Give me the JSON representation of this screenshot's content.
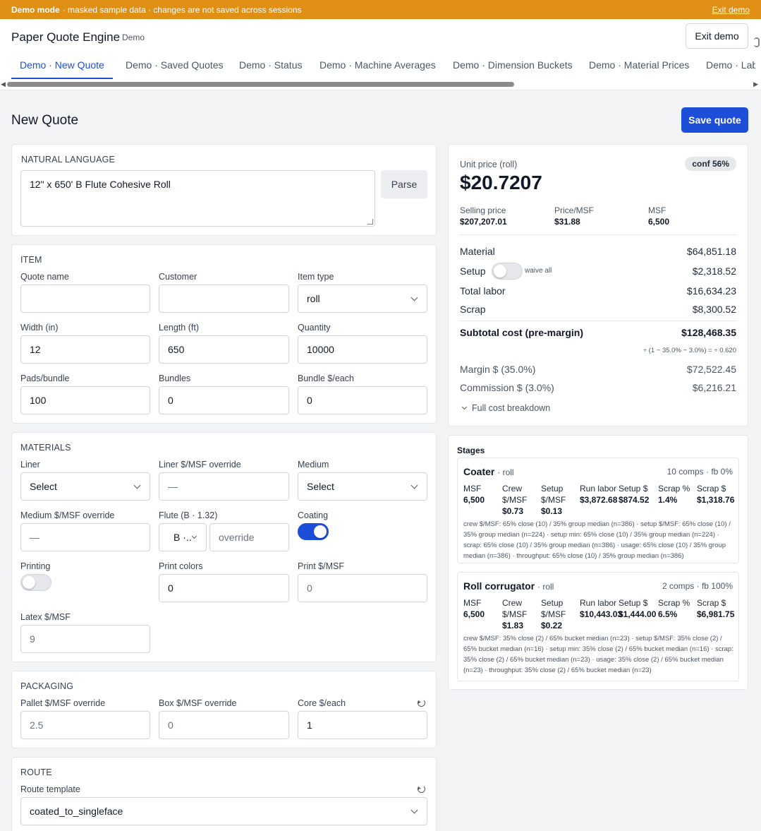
{
  "banner": {
    "mode": "Demo mode",
    "message": "· masked sample data · changes are not saved across sessions",
    "exit": "Exit demo"
  },
  "header": {
    "app_title": "Paper Quote Engine",
    "app_tag": "Demo",
    "exit_button": "Exit demo"
  },
  "tabs": [
    {
      "label": "Demo · New Quote",
      "active": true
    },
    {
      "label": "Demo · Saved Quotes"
    },
    {
      "label": "Demo · Status"
    },
    {
      "label": "Demo · Machine Averages"
    },
    {
      "label": "Demo · Dimension Buckets"
    },
    {
      "label": "Demo · Material Prices"
    },
    {
      "label": "Demo · Lab"
    }
  ],
  "page": {
    "title": "New Quote",
    "save_button": "Save quote"
  },
  "natural_language": {
    "title": "NATURAL LANGUAGE",
    "value": "12\" x 650' B Flute Cohesive Roll",
    "parse_button": "Parse"
  },
  "item": {
    "title": "ITEM",
    "quote_name": {
      "label": "Quote name",
      "value": ""
    },
    "customer": {
      "label": "Customer",
      "value": ""
    },
    "item_type": {
      "label": "Item type",
      "value": "roll"
    },
    "width": {
      "label": "Width (in)",
      "value": "12"
    },
    "length": {
      "label": "Length (ft)",
      "value": "650"
    },
    "quantity": {
      "label": "Quantity",
      "value": "10000"
    },
    "pads_bundle": {
      "label": "Pads/bundle",
      "value": "100"
    },
    "bundles": {
      "label": "Bundles",
      "value": "0"
    },
    "bundle_each": {
      "label": "Bundle $/each",
      "value": "0"
    }
  },
  "materials": {
    "title": "MATERIALS",
    "liner": {
      "label": "Liner",
      "value": "Select"
    },
    "liner_override": {
      "label": "Liner $/MSF override",
      "value": "—"
    },
    "medium": {
      "label": "Medium",
      "value": "Select"
    },
    "medium_override": {
      "label": "Medium $/MSF override",
      "value": "—"
    },
    "flute": {
      "label": "Flute (B · 1.32)",
      "value": "B ·..",
      "override_placeholder": "override"
    },
    "coating": {
      "label": "Coating",
      "on": true
    },
    "printing": {
      "label": "Printing",
      "on": false
    },
    "print_colors": {
      "label": "Print colors",
      "value": "0"
    },
    "print_msf": {
      "label": "Print $/MSF",
      "value": "0"
    },
    "latex_msf": {
      "label": "Latex $/MSF",
      "value": "9"
    }
  },
  "packaging": {
    "title": "PACKAGING",
    "pallet": {
      "label": "Pallet $/MSF override",
      "value": "2.5"
    },
    "box": {
      "label": "Box $/MSF override",
      "value": "0"
    },
    "core": {
      "label": "Core $/each",
      "value": "1"
    }
  },
  "route": {
    "title": "ROUTE",
    "template": {
      "label": "Route template",
      "value": "coated_to_singleface"
    }
  },
  "summary": {
    "unit_label": "Unit price (roll)",
    "confidence": "conf 56%",
    "unit_price": "$20.7207",
    "selling_label": "Selling price",
    "selling_value": "$207,207.01",
    "price_msf_label": "Price/MSF",
    "price_msf_value": "$31.88",
    "msf_label": "MSF",
    "msf_value": "6,500",
    "material_label": "Material",
    "material_value": "$64,851.18",
    "setup_label": "Setup",
    "waive_label": "waive all",
    "setup_value": "$2,318.52",
    "labor_label": "Total labor",
    "labor_value": "$16,634.23",
    "scrap_label": "Scrap",
    "scrap_value": "$8,300.52",
    "subtotal_label": "Subtotal cost (pre-margin)",
    "subtotal_value": "$128,468.35",
    "formula": "÷ (1 − 35.0% − 3.0%) = ÷ 0.620",
    "margin_label": "Margin $ (35.0%)",
    "margin_value": "$72,522.45",
    "commission_label": "Commission $ (3.0%)",
    "commission_value": "$6,216.21",
    "breakdown_link": "Full cost breakdown"
  },
  "stages": {
    "title": "Stages",
    "items": [
      {
        "name": "Coater",
        "kind": "· roll",
        "meta": "10 comps · fb 0%",
        "cols": [
          {
            "h": "MSF",
            "v": "6,500"
          },
          {
            "h": "Crew $/MSF",
            "v": "$0.73"
          },
          {
            "h": "Setup $/MSF",
            "v": "$0.13"
          },
          {
            "h": "Run labor",
            "v": "$3,872.68"
          },
          {
            "h": "Setup $",
            "v": "$874.52"
          },
          {
            "h": "Scrap %",
            "v": "1.4%"
          },
          {
            "h": "Scrap $",
            "v": "$1,318.76"
          }
        ],
        "note": "crew $/MSF: 65% close (10) / 35% group median (n=386) · setup $/MSF: 65% close (10) / 35% group median (n=224) · setup min: 65% close (10) / 35% group median (n=224) · scrap: 65% close (10) / 35% group median (n=386) · usage: 65% close (10) / 35% group median (n=386) · throughput: 65% close (10) / 35% group median (n=386)"
      },
      {
        "name": "Roll corrugator",
        "kind": "· roll",
        "meta": "2 comps · fb 100%",
        "cols": [
          {
            "h": "MSF",
            "v": "6,500"
          },
          {
            "h": "Crew $/MSF",
            "v": "$1.83"
          },
          {
            "h": "Setup $/MSF",
            "v": "$0.22"
          },
          {
            "h": "Run labor",
            "v": "$10,443.03"
          },
          {
            "h": "Setup $",
            "v": "$1,444.00"
          },
          {
            "h": "Scrap %",
            "v": "6.5%"
          },
          {
            "h": "Scrap $",
            "v": "$6,981.75"
          }
        ],
        "note": "crew $/MSF: 35% close (2) / 65% bucket median (n=23) · setup $/MSF: 35% close (2) / 65% bucket median (n=16) · setup min: 35% close (2) / 65% bucket median (n=16) · scrap: 35% close (2) / 65% bucket median (n=23) · usage: 35% close (2) / 65% bucket median (n=23) · throughput: 35% close (2) / 65% bucket median (n=23)"
      }
    ]
  },
  "icons": [
    "chevron-down-icon",
    "reset-icon",
    "scroll-arrow-left-icon",
    "scroll-arrow-right-icon"
  ],
  "colors": {
    "banner": "#df8f13",
    "accent": "#1d4ed8"
  }
}
